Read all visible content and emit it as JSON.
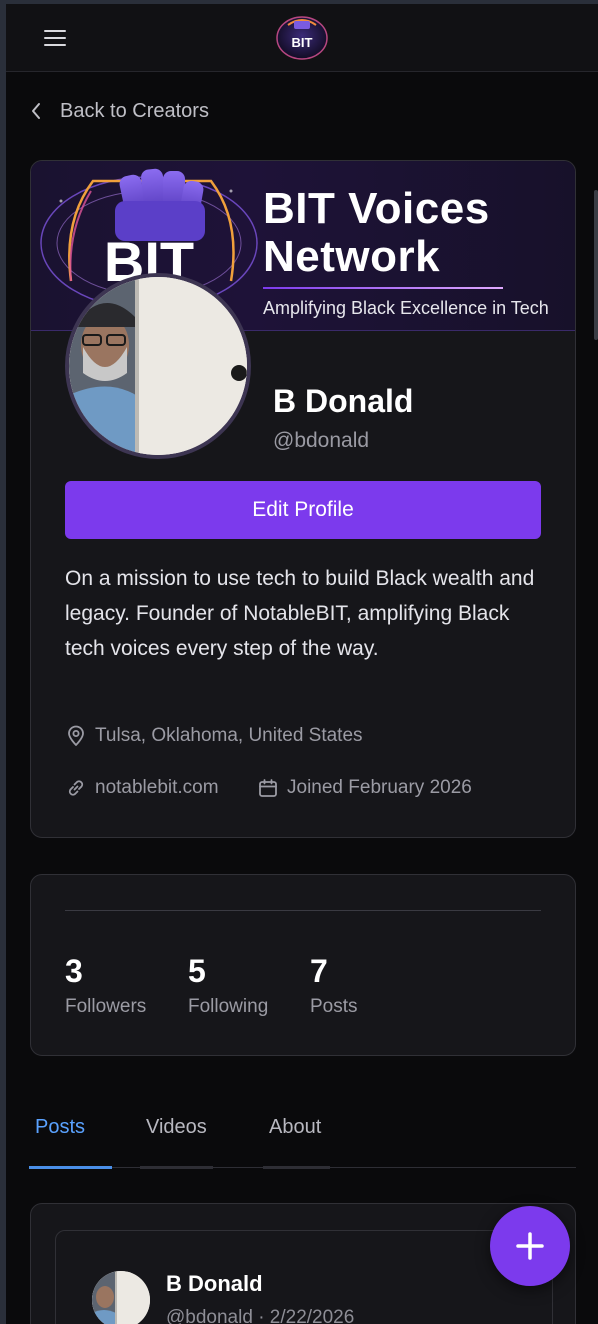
{
  "header": {
    "logo_text": "BIT"
  },
  "nav": {
    "back_label": "Back to Creators"
  },
  "banner": {
    "logo_text": "BIT",
    "title_line1": "BIT Voices",
    "title_line2": "Network",
    "tagline": "Amplifying Black Excellence in Tech"
  },
  "profile": {
    "name": "B Donald",
    "handle": "@bdonald",
    "edit_label": "Edit Profile",
    "bio": "On a mission to use tech to build Black wealth and legacy. Founder of NotableBIT, amplifying Black tech voices every step of the way.",
    "location": "Tulsa, Oklahoma, United States",
    "website": "notablebit.com",
    "joined": "Joined February 2026"
  },
  "stats": [
    {
      "value": "3",
      "label": "Followers"
    },
    {
      "value": "5",
      "label": "Following"
    },
    {
      "value": "7",
      "label": "Posts"
    }
  ],
  "tabs": [
    {
      "label": "Posts",
      "active": true
    },
    {
      "label": "Videos",
      "active": false
    },
    {
      "label": "About",
      "active": false
    }
  ],
  "post": {
    "author": "B Donald",
    "meta": "@bdonald · 2/22/2026"
  },
  "colors": {
    "accent": "#7c3aed",
    "tab_active": "#5aa2ff",
    "background": "#0a0a0c",
    "card": "#16161a"
  },
  "icons": {
    "menu": "menu-icon",
    "back": "chevron-left-icon",
    "location": "map-pin-icon",
    "link": "link-icon",
    "calendar": "calendar-icon",
    "fab": "plus-icon"
  }
}
